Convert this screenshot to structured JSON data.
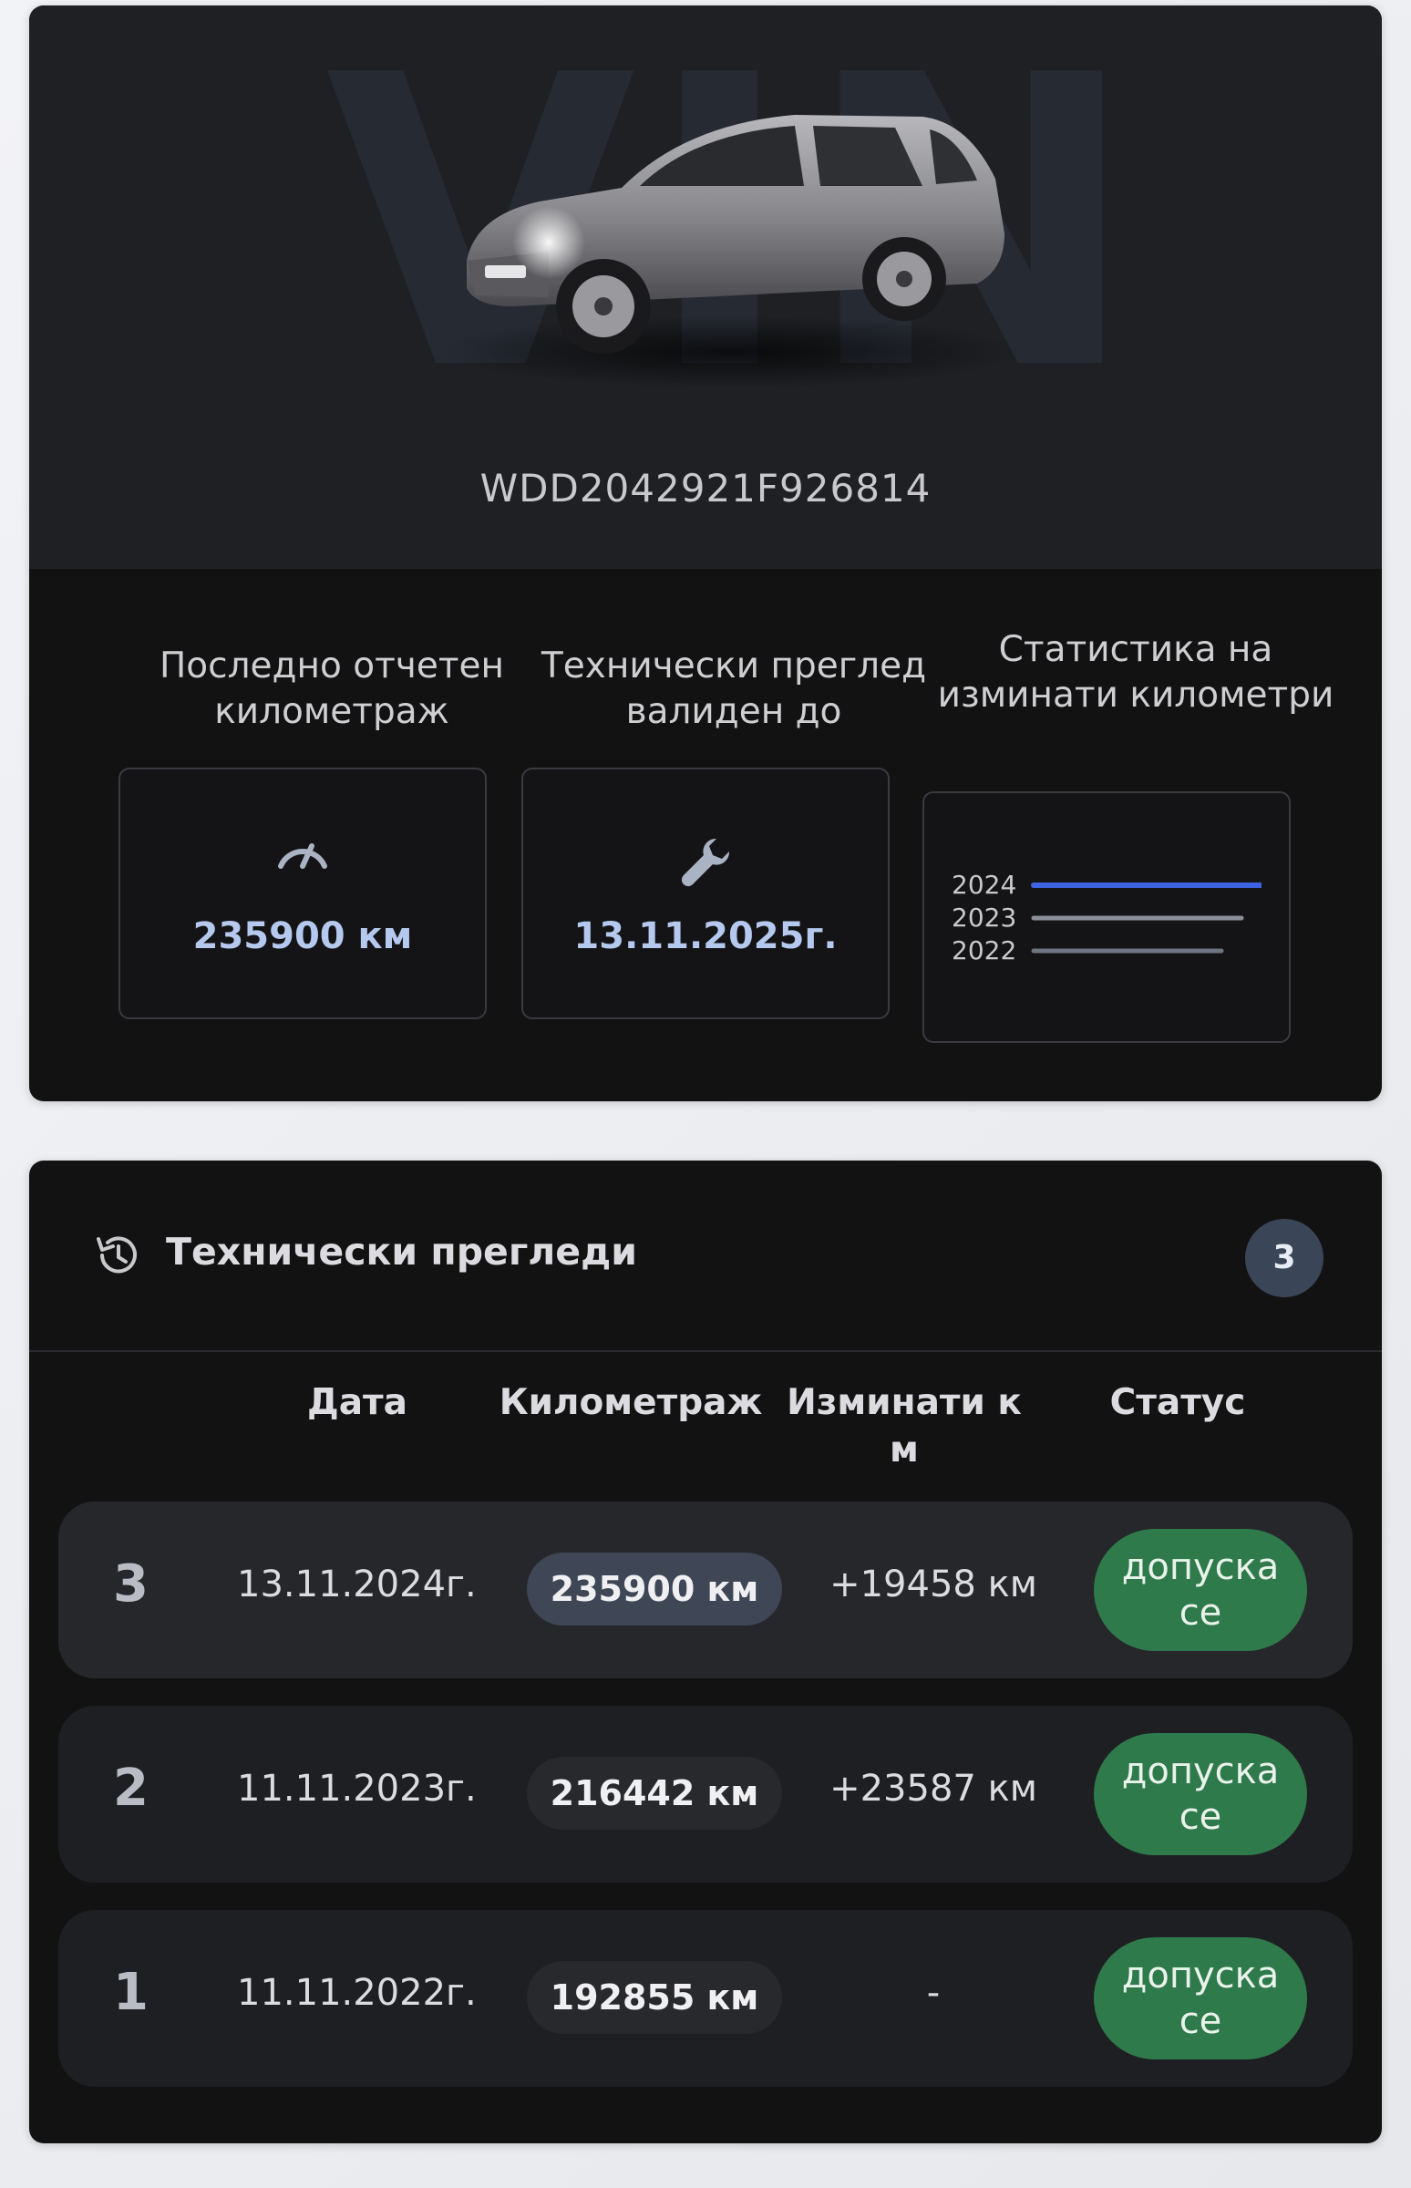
{
  "vehicle": {
    "vin": "WDD2042921F926814",
    "watermark": "VIN"
  },
  "stats": {
    "mileage": {
      "label": "Последно отчетен километраж",
      "value": "235900 км",
      "icon": "speedometer-icon"
    },
    "inspection": {
      "label": "Технически преглед валиден до",
      "value": "13.11.2025г.",
      "icon": "wrench-icon"
    },
    "driven": {
      "label": "Статистика на изминати километри",
      "years": [
        "2024",
        "2023",
        "2022"
      ],
      "colors": [
        "#3d63e0",
        "#8a8f9a",
        "#6f7580"
      ]
    }
  },
  "inspections": {
    "title": "Технически прегледи",
    "count": "3",
    "icon": "history-icon",
    "headers": {
      "date": "Дата",
      "mileage": "Километраж",
      "driven": "Изминати к\nм",
      "status": "Статус"
    },
    "rows": [
      {
        "num": "3",
        "date": "13.11.2024г.",
        "mileage": "235900 км",
        "diff": "+19458 км",
        "status": "допуска се"
      },
      {
        "num": "2",
        "date": "11.11.2023г.",
        "mileage": "216442 км",
        "diff": "+23587 км",
        "status": "допуска се"
      },
      {
        "num": "1",
        "date": "11.11.2022г.",
        "mileage": "192855 км",
        "diff": "-",
        "status": "допуска се"
      }
    ]
  },
  "colors": {
    "accent_blue": "#b5c8ee",
    "status_green": "#2e7a4b",
    "bar_2024": "#3d63e0"
  }
}
